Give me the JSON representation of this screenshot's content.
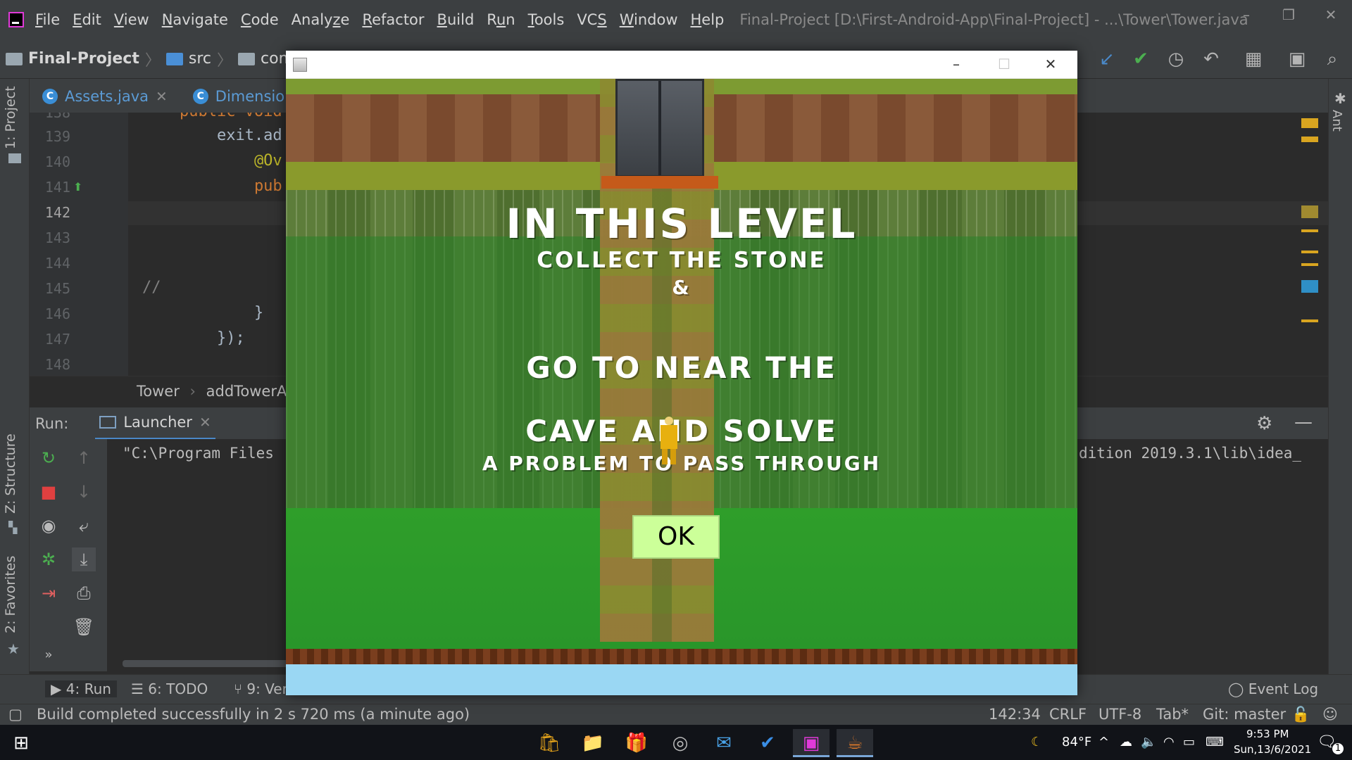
{
  "menu": {
    "items": [
      {
        "label": "File",
        "u": "F"
      },
      {
        "label": "Edit",
        "u": "E"
      },
      {
        "label": "View",
        "u": "V"
      },
      {
        "label": "Navigate",
        "u": "N"
      },
      {
        "label": "Code",
        "u": "C"
      },
      {
        "label": "Analyze",
        "u": "z"
      },
      {
        "label": "Refactor",
        "u": "R"
      },
      {
        "label": "Build",
        "u": "B"
      },
      {
        "label": "Run",
        "u": "u"
      },
      {
        "label": "Tools",
        "u": "T"
      },
      {
        "label": "VCS",
        "u": "S"
      },
      {
        "label": "Window",
        "u": "W"
      },
      {
        "label": "Help",
        "u": "H"
      }
    ],
    "window_title": "Final-Project [D:\\First-Android-App\\Final-Project] - ...\\Tower\\Tower.java"
  },
  "breadcrumbs": [
    "Final-Project",
    "src",
    "com"
  ],
  "left_stripe": {
    "project_tab": "1: Project",
    "structure_tab": "Z: Structure",
    "favorites_tab": "2: Favorites"
  },
  "right_stripe": {
    "ant_tab": "Ant"
  },
  "editor_tabs": [
    {
      "label": "Assets.java"
    },
    {
      "label": "Dimension.ja"
    }
  ],
  "editor": {
    "current_line": "142",
    "lines": [
      {
        "num": "138",
        "code": "    public void"
      },
      {
        "num": "139",
        "code": "        exit.ad"
      },
      {
        "num": "140",
        "code": "            @Ov"
      },
      {
        "num": "141",
        "code": "            pub"
      },
      {
        "num": "142",
        "code": ""
      },
      {
        "num": "143",
        "code": ""
      },
      {
        "num": "144",
        "code": ""
      },
      {
        "num": "145",
        "code": "//"
      },
      {
        "num": "146",
        "code": "            }"
      },
      {
        "num": "147",
        "code": "        });"
      },
      {
        "num": "148",
        "code": ""
      }
    ]
  },
  "code_crumbs": {
    "class": "Tower",
    "method": "addTowerAc"
  },
  "run_panel": {
    "label": "Run:",
    "tab": "Launcher",
    "console_left": "\"C:\\Program Files",
    "console_right": "dition 2019.3.1\\lib\\idea_"
  },
  "bottom_tabs": {
    "run": "4: Run",
    "todo": "6: TODO",
    "vcs": "9: Ver",
    "event_log": "Event Log"
  },
  "status": {
    "message": "Build completed successfully in 2 s 720 ms (a minute ago)",
    "position": "142:34",
    "line_sep": "CRLF",
    "encoding": "UTF-8",
    "indent": "Tab*",
    "git": "Git: master"
  },
  "game": {
    "line1": "IN THIS LEVEL",
    "line2": "COLLECT THE STONE",
    "line3": "&",
    "line4": "GO TO NEAR THE",
    "line5": "CAVE AND SOLVE",
    "line6": "A PROBLEM TO PASS THROUGH",
    "ok_label": "OK"
  },
  "taskbar": {
    "temperature": "84°F",
    "time": "9:53 PM",
    "date": "Sun,13/6/2021",
    "notification_count": "1"
  },
  "colors": {
    "ide_bg": "#2b2b2b",
    "ide_panel": "#3c3f41",
    "ok_button": "#ccff99",
    "accent_blue": "#4a88c7"
  }
}
